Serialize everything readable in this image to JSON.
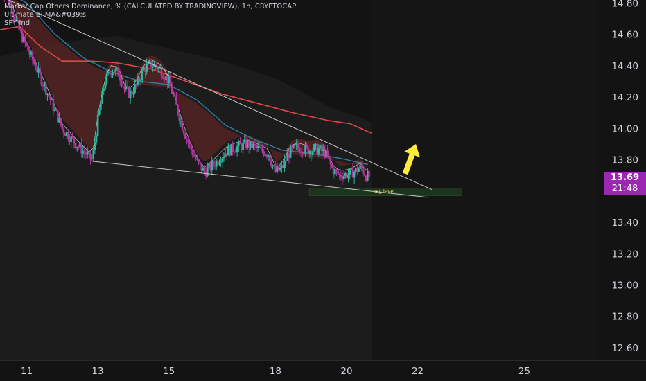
{
  "legend": {
    "title": "Market Cap Others Dominance, % (CALCULATED BY TRADINGVIEW), 1h, CRYPTOCAP",
    "indicator1": "Ultimate Bi MA&#039;s",
    "indicator2": "SPY Ind"
  },
  "price_tag": {
    "price": "13.69",
    "countdown": "21:48",
    "color": "#9c27b0"
  },
  "annotation": {
    "label": "key level",
    "label_color": "#ffeb3b",
    "arrow_color": "#ffeb3b",
    "zone_color": "#1e3a1e"
  },
  "colors": {
    "background": "#131313",
    "axis_text": "#d1d4dc",
    "up_candle": "#2fb89a",
    "down_candle": "#b3369f",
    "red_ma": "#e04848",
    "blue_ma": "#2f7fa8",
    "white_line": "#ffffff",
    "trendline": "#c8c8c8"
  },
  "chart_data": {
    "type": "candlestick",
    "title": "Market Cap Others Dominance, % (CALCULATED BY TRADINGVIEW), 1h, CRYPTOCAP",
    "y_ticks": [
      14.8,
      14.6,
      14.4,
      14.2,
      14.0,
      13.8,
      13.4,
      13.2,
      13.0,
      12.8,
      12.6
    ],
    "x_ticks": [
      {
        "label": "11",
        "day": 11
      },
      {
        "label": "13",
        "day": 13
      },
      {
        "label": "15",
        "day": 15
      },
      {
        "label": "18",
        "day": 18
      },
      {
        "label": "20",
        "day": 20
      },
      {
        "label": "22",
        "day": 22
      },
      {
        "label": "25",
        "day": 25
      }
    ],
    "ylim": [
      12.52,
      14.82
    ],
    "xlim": [
      10.25,
      27.02
    ],
    "last_price": 13.69,
    "close_path": [
      [
        10.25,
        14.9
      ],
      [
        10.5,
        14.82
      ],
      [
        10.8,
        14.62
      ],
      [
        11.2,
        14.42
      ],
      [
        11.6,
        14.22
      ],
      [
        12.0,
        14.0
      ],
      [
        12.4,
        13.9
      ],
      [
        12.7,
        13.83
      ],
      [
        12.85,
        13.8
      ],
      [
        13.0,
        14.05
      ],
      [
        13.2,
        14.3
      ],
      [
        13.4,
        14.38
      ],
      [
        13.6,
        14.35
      ],
      [
        13.75,
        14.25
      ],
      [
        13.9,
        14.22
      ],
      [
        14.1,
        14.28
      ],
      [
        14.3,
        14.38
      ],
      [
        14.5,
        14.41
      ],
      [
        14.75,
        14.38
      ],
      [
        15.0,
        14.3
      ],
      [
        15.2,
        14.15
      ],
      [
        15.4,
        14.0
      ],
      [
        15.6,
        13.88
      ],
      [
        15.8,
        13.78
      ],
      [
        16.0,
        13.72
      ],
      [
        16.3,
        13.78
      ],
      [
        16.6,
        13.85
      ],
      [
        16.9,
        13.88
      ],
      [
        17.2,
        13.9
      ],
      [
        17.5,
        13.87
      ],
      [
        17.8,
        13.84
      ],
      [
        18.0,
        13.72
      ],
      [
        18.2,
        13.75
      ],
      [
        18.4,
        13.85
      ],
      [
        18.6,
        13.88
      ],
      [
        18.9,
        13.86
      ],
      [
        19.2,
        13.87
      ],
      [
        19.4,
        13.84
      ],
      [
        19.6,
        13.74
      ],
      [
        19.8,
        13.7
      ],
      [
        20.1,
        13.71
      ],
      [
        20.4,
        13.75
      ],
      [
        20.55,
        13.7
      ],
      [
        20.65,
        13.69
      ]
    ],
    "red_ma": [
      [
        10.25,
        14.63
      ],
      [
        10.8,
        14.65
      ],
      [
        11.4,
        14.52
      ],
      [
        12.0,
        14.43
      ],
      [
        12.8,
        14.43
      ],
      [
        13.5,
        14.42
      ],
      [
        14.5,
        14.38
      ],
      [
        15.5,
        14.3
      ],
      [
        16.5,
        14.22
      ],
      [
        17.5,
        14.16
      ],
      [
        18.5,
        14.1
      ],
      [
        19.5,
        14.05
      ],
      [
        20.1,
        14.03
      ],
      [
        20.7,
        13.97
      ]
    ],
    "blue_ma": [
      [
        10.25,
        14.9
      ],
      [
        11.0,
        14.8
      ],
      [
        11.8,
        14.6
      ],
      [
        12.6,
        14.45
      ],
      [
        13.4,
        14.36
      ],
      [
        14.2,
        14.3
      ],
      [
        15.0,
        14.28
      ],
      [
        15.8,
        14.18
      ],
      [
        16.6,
        14.02
      ],
      [
        17.4,
        13.93
      ],
      [
        18.2,
        13.86
      ],
      [
        19.0,
        13.84
      ],
      [
        19.8,
        13.81
      ],
      [
        20.6,
        13.77
      ]
    ],
    "trendlines": [
      {
        "name": "resistance",
        "from": [
          10.3,
          14.84
        ],
        "to": [
          22.4,
          13.61
        ]
      },
      {
        "name": "support",
        "from": [
          12.85,
          13.79
        ],
        "to": [
          22.3,
          13.56
        ]
      }
    ],
    "crosshair_y": 13.76,
    "key_zone": {
      "x_from": 18.95,
      "x_to": 23.25,
      "y_from": 13.57,
      "y_to": 13.62
    },
    "arrow": {
      "from": [
        21.65,
        13.71
      ],
      "to": [
        21.95,
        13.9
      ]
    },
    "shaded_band": [
      [
        10.25,
        14.46
      ],
      [
        12.0,
        14.55
      ],
      [
        13.5,
        14.59
      ],
      [
        15.0,
        14.51
      ],
      [
        16.5,
        14.43
      ],
      [
        18.0,
        14.32
      ],
      [
        19.5,
        14.14
      ],
      [
        20.7,
        14.04
      ]
    ]
  }
}
